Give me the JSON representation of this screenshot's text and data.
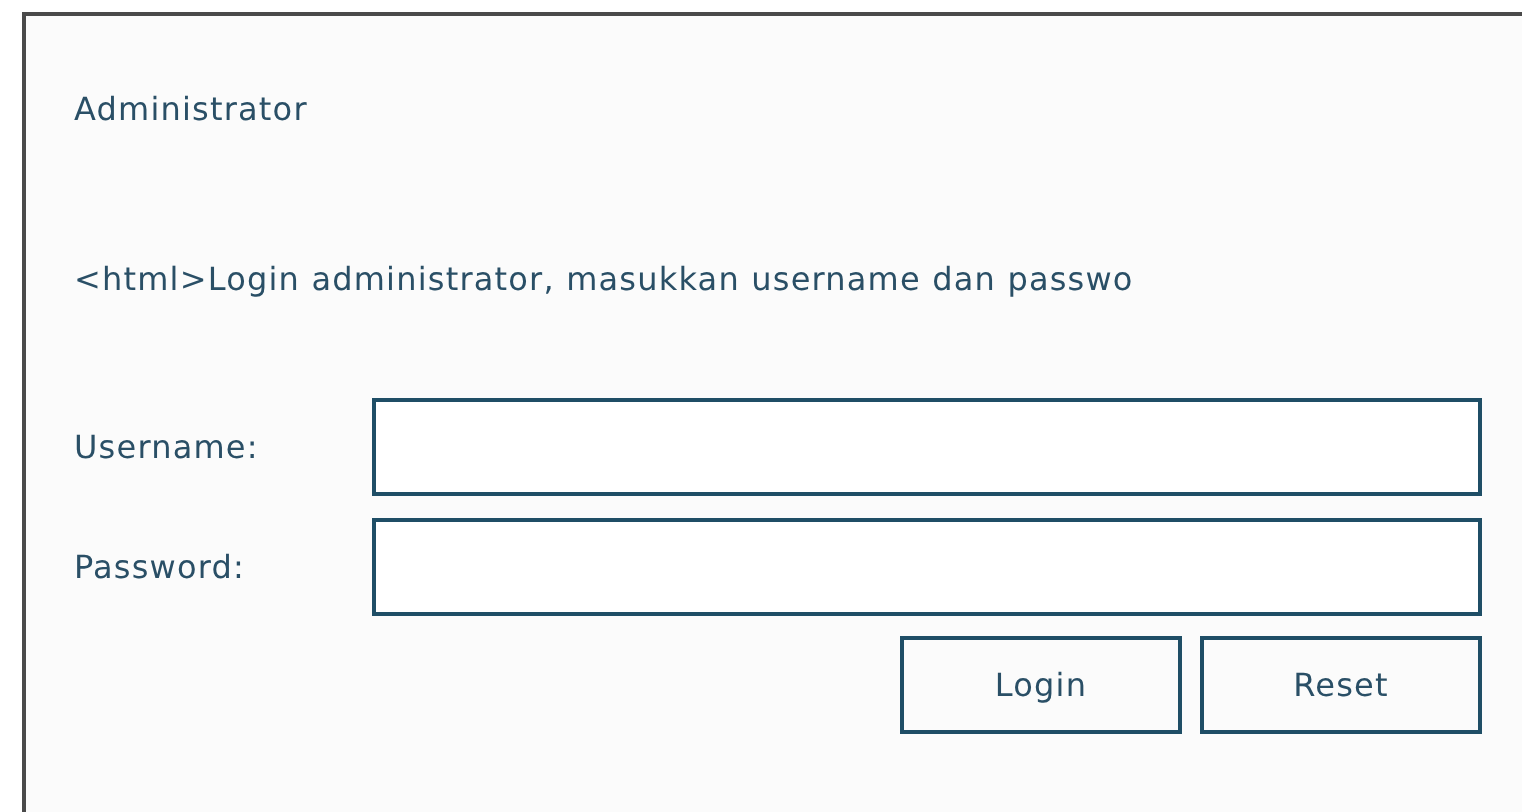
{
  "title": "Administrator",
  "instruction": "<html>Login administrator, masukkan username dan passwo",
  "fields": [
    {
      "label": "Username:"
    },
    {
      "label": "Password:"
    }
  ],
  "buttons": [
    "Login",
    "Reset"
  ]
}
